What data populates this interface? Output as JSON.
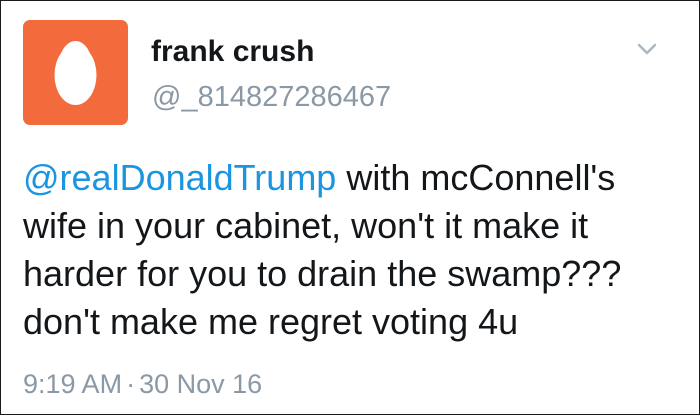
{
  "profile": {
    "display_name": "frank crush",
    "handle": "@_814827286467",
    "avatar_icon": "default-egg-avatar",
    "avatar_color": "#f36b3c"
  },
  "tweet": {
    "mention": "@realDonaldTrump",
    "lines": [
      " with mcConnell's",
      "wife in your cabinet, won't it make it",
      "harder for you to drain the swamp???",
      "don't make me regret voting 4u"
    ]
  },
  "meta": {
    "time": "9:19 AM",
    "separator": "·",
    "date": "30 Nov 16"
  },
  "icons": {
    "menu": "chevron-down-icon"
  },
  "colors": {
    "link": "#1b95e0",
    "text": "#14171a",
    "muted": "#8b98a5"
  }
}
